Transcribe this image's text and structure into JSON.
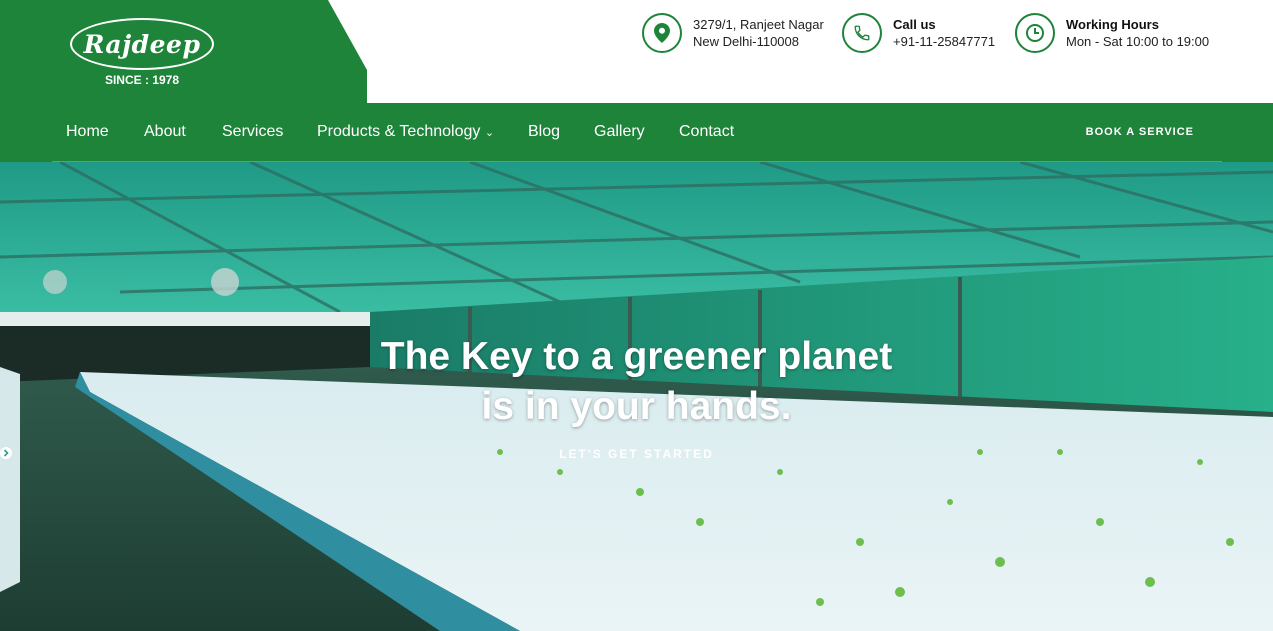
{
  "brand": {
    "name": "Rajdeep",
    "since": "SINCE : 1978",
    "color": "#1e843a"
  },
  "contact": {
    "address_line1": "3279/1, Ranjeet Nagar",
    "address_line2": "New Delhi-110008",
    "call_title": "Call us",
    "phone": "+91-11-25847771",
    "hours_title": "Working Hours",
    "hours": "Mon - Sat 10:00 to 19:00"
  },
  "icons": {
    "address": "map-marker-icon",
    "phone": "phone-icon",
    "hours": "clock-icon"
  },
  "nav": {
    "items": [
      "Home",
      "About",
      "Services",
      "Products & Technology",
      "Blog",
      "Gallery",
      "Contact"
    ],
    "dropdown_glyph": "⌄",
    "book_label": "BOOK A SERVICE"
  },
  "hero": {
    "title_line1": "The Key to a greener planet",
    "title_line2": "is in your hands.",
    "cta_label": "LET'S GET STARTED",
    "cta_icon": "arrow-circle-right-icon"
  }
}
